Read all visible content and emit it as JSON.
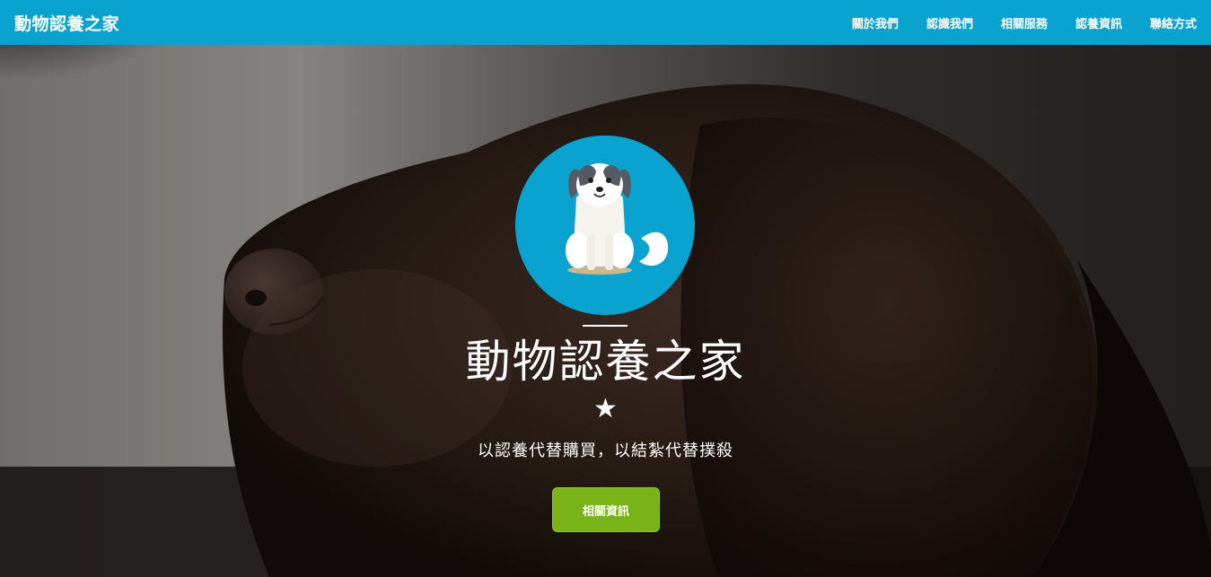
{
  "navbar": {
    "brand": "動物認養之家",
    "links": [
      {
        "label": "關於我們"
      },
      {
        "label": "認識我們"
      },
      {
        "label": "相關服務"
      },
      {
        "label": "認養資訊"
      },
      {
        "label": "聯絡方式"
      }
    ]
  },
  "hero": {
    "title": "動物認養之家",
    "star": "★",
    "subtitle": "以認養代替購買，以結紮代替撲殺",
    "button_label": "相關資訊",
    "background_subject": "dark-brown-dog-photo",
    "avatar_subject": "cartoon-dog-icon"
  },
  "colors": {
    "primary": "#0aa3cf",
    "button": "#7ab317",
    "text": "#ffffff"
  }
}
